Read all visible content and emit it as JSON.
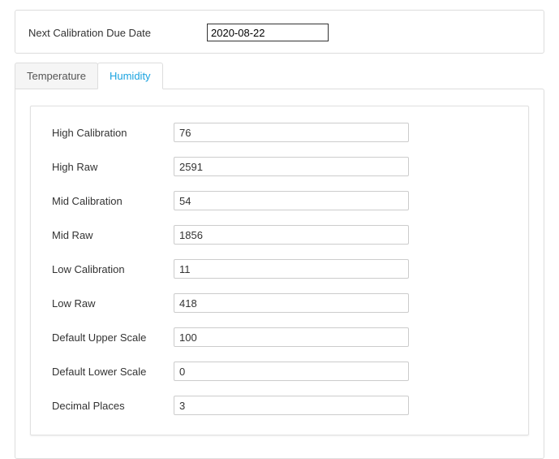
{
  "top": {
    "date_label": "Next Calibration Due Date",
    "date_value": "2020-08-22"
  },
  "tabs": {
    "temperature": "Temperature",
    "humidity": "Humidity",
    "active": "humidity"
  },
  "form": {
    "high_cal": {
      "label": "High Calibration",
      "value": "76"
    },
    "high_raw": {
      "label": "High Raw",
      "value": "2591"
    },
    "mid_cal": {
      "label": "Mid Calibration",
      "value": "54"
    },
    "mid_raw": {
      "label": "Mid Raw",
      "value": "1856"
    },
    "low_cal": {
      "label": "Low Calibration",
      "value": "11"
    },
    "low_raw": {
      "label": "Low Raw",
      "value": "418"
    },
    "upper": {
      "label": "Default Upper Scale",
      "value": "100"
    },
    "lower": {
      "label": "Default Lower Scale",
      "value": "0"
    },
    "decimals": {
      "label": "Decimal Places",
      "value": "3"
    }
  }
}
